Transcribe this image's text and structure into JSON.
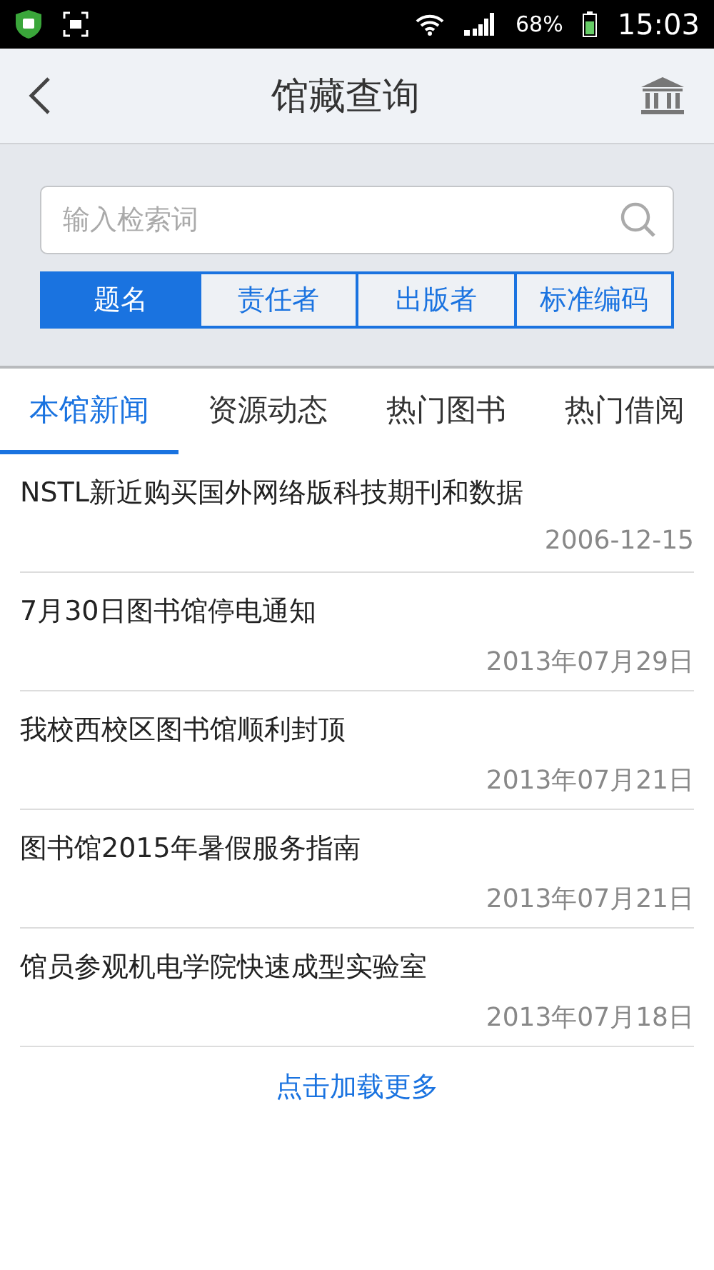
{
  "status_bar": {
    "battery": "68%",
    "time": "15:03"
  },
  "header": {
    "title": "馆藏查询"
  },
  "search": {
    "placeholder": "输入检索词"
  },
  "search_types": [
    {
      "label": "题名",
      "selected": true
    },
    {
      "label": "责任者",
      "selected": false
    },
    {
      "label": "出版者",
      "selected": false
    },
    {
      "label": "标准编码",
      "selected": false
    }
  ],
  "tabs": [
    {
      "label": "本馆新闻",
      "selected": true
    },
    {
      "label": "资源动态",
      "selected": false
    },
    {
      "label": "热门图书",
      "selected": false
    },
    {
      "label": "热门借阅",
      "selected": false
    }
  ],
  "news": [
    {
      "title": "NSTL新近购买国外网络版科技期刊和数据",
      "date": "2006-12-15"
    },
    {
      "title": "7月30日图书馆停电通知",
      "date": "2013年07月29日"
    },
    {
      "title": "我校西校区图书馆顺利封顶",
      "date": "2013年07月21日"
    },
    {
      "title": "图书馆2015年暑假服务指南",
      "date": "2013年07月21日"
    },
    {
      "title": "馆员参观机电学院快速成型实验室",
      "date": "2013年07月18日"
    }
  ],
  "load_more": "点击加载更多"
}
